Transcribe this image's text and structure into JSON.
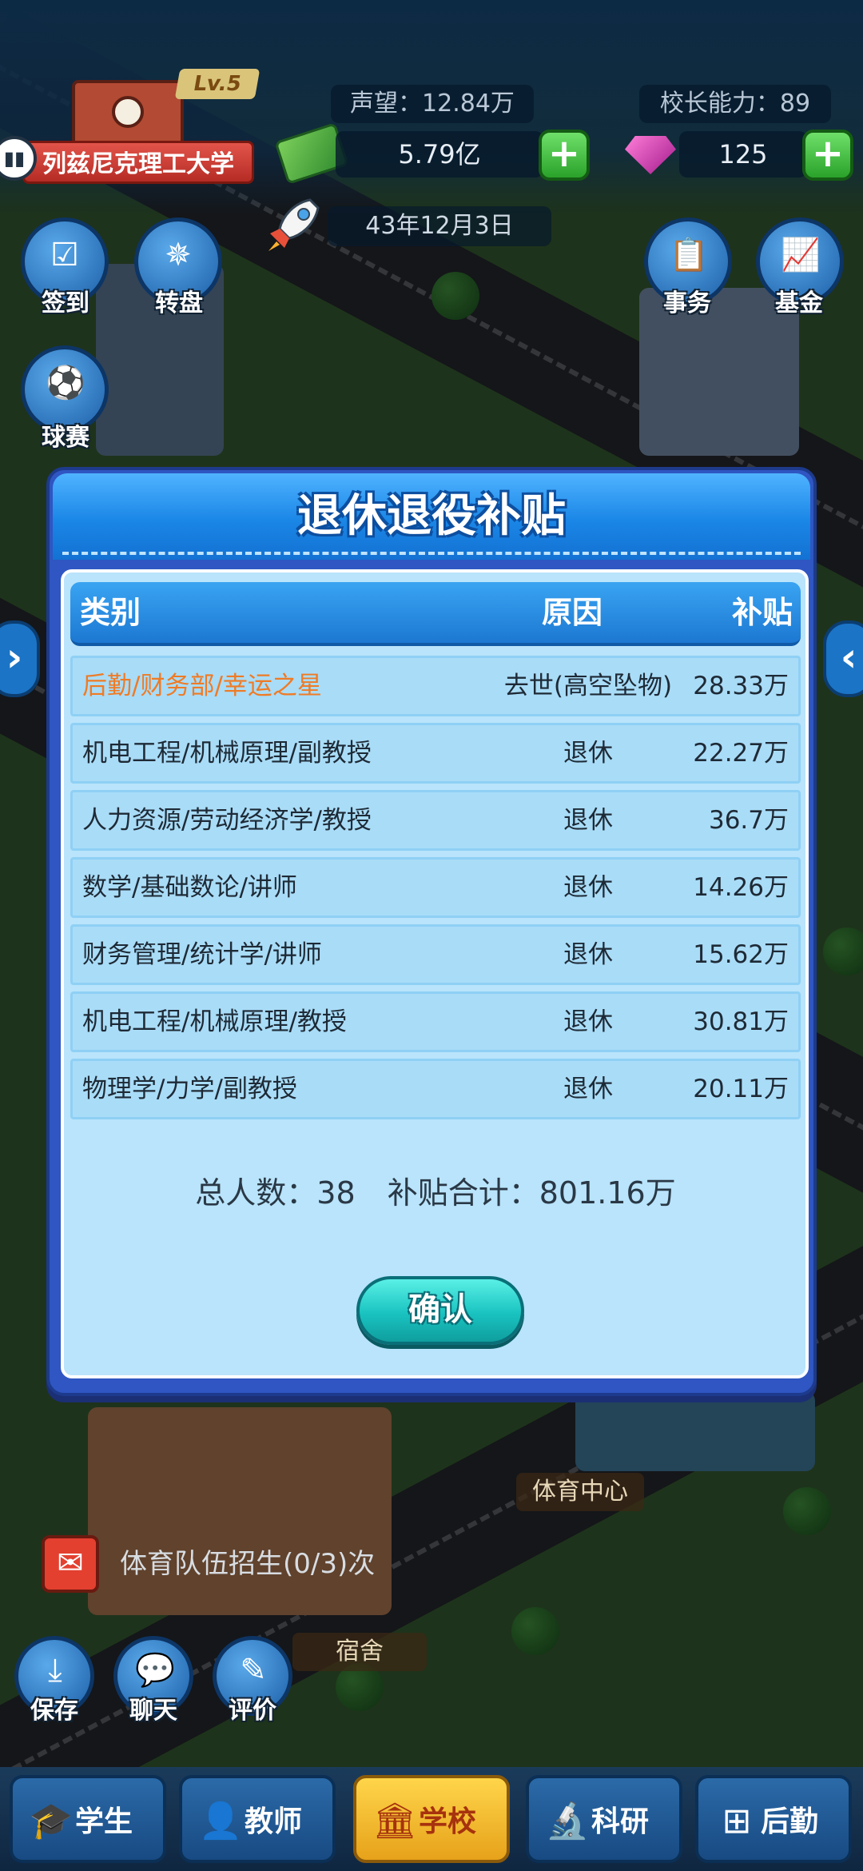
{
  "hud": {
    "level": "Lv.5",
    "school_name": "列兹尼克理工大学",
    "prestige": "声望：12.84万",
    "principal_ability": "校长能力：89",
    "money": "5.79亿",
    "gems": "125",
    "date": "43年12月3日"
  },
  "side_buttons": {
    "checkin": "签到",
    "wheel": "转盘",
    "match": "球赛",
    "affairs": "事务",
    "fund": "基金"
  },
  "map_signs": {
    "sports_center": "体育中心",
    "dorm": "宿舍",
    "recruit_notice": "体育队伍招生(0/3)次"
  },
  "bottom_buttons": {
    "save": "保存",
    "chat": "聊天",
    "review": "评价"
  },
  "tabs": [
    {
      "label": "学生",
      "icon": "graduation-cap-icon"
    },
    {
      "label": "教师",
      "icon": "teacher-icon"
    },
    {
      "label": "学校",
      "icon": "school-building-icon"
    },
    {
      "label": "科研",
      "icon": "microscope-icon"
    },
    {
      "label": "后勤",
      "icon": "first-aid-icon"
    }
  ],
  "dialog": {
    "title": "退休退役补贴",
    "columns": {
      "category": "类别",
      "reason": "原因",
      "subsidy": "补贴"
    },
    "rows": [
      {
        "category": "后勤/财务部/幸运之星",
        "reason": "去世(高空坠物)",
        "subsidy": "28.33万"
      },
      {
        "category": "机电工程/机械原理/副教授",
        "reason": "退休",
        "subsidy": "22.27万"
      },
      {
        "category": "人力资源/劳动经济学/教授",
        "reason": "退休",
        "subsidy": "36.7万"
      },
      {
        "category": "数学/基础数论/讲师",
        "reason": "退休",
        "subsidy": "14.26万"
      },
      {
        "category": "财务管理/统计学/讲师",
        "reason": "退休",
        "subsidy": "15.62万"
      },
      {
        "category": "机电工程/机械原理/教授",
        "reason": "退休",
        "subsidy": "30.81万"
      },
      {
        "category": "物理学/力学/副教授",
        "reason": "退休",
        "subsidy": "20.11万"
      }
    ],
    "total_people": "总人数：38",
    "total_subsidy": "补贴合计：801.16万",
    "confirm": "确认"
  },
  "colors": {
    "highlight_row_text": "#ef7b25",
    "dialog_frame": "#2f56c2",
    "confirm_button": "#19c3c0"
  }
}
